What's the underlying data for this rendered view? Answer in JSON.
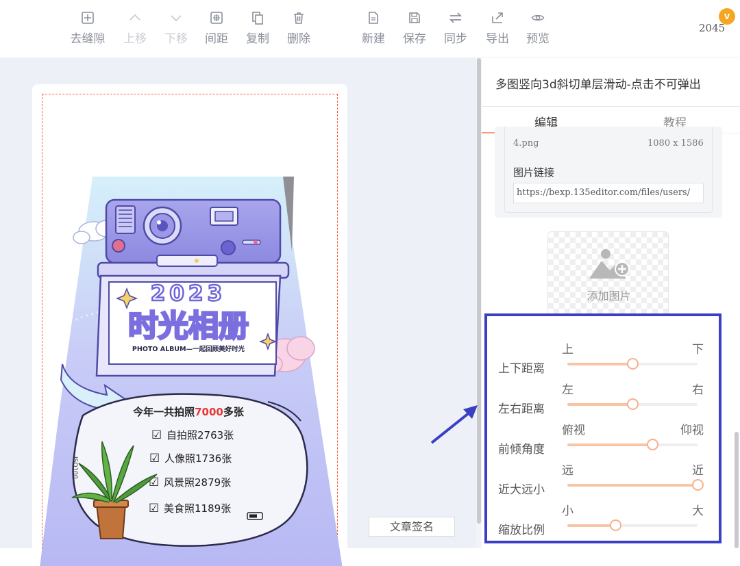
{
  "toolbar": {
    "buttons": [
      {
        "label": "去缝隙",
        "icon": "plus-square-icon",
        "enabled": true
      },
      {
        "label": "上移",
        "icon": "chevron-up-icon",
        "enabled": false
      },
      {
        "label": "下移",
        "icon": "chevron-down-icon",
        "enabled": false
      },
      {
        "label": "间距",
        "icon": "spacing-icon",
        "enabled": true
      },
      {
        "label": "复制",
        "icon": "copy-icon",
        "enabled": true
      },
      {
        "label": "删除",
        "icon": "trash-icon",
        "enabled": true
      },
      {
        "label": "新建",
        "icon": "new-file-icon",
        "enabled": true
      },
      {
        "label": "保存",
        "icon": "save-icon",
        "enabled": true
      },
      {
        "label": "同步",
        "icon": "sync-icon",
        "enabled": true
      },
      {
        "label": "导出",
        "icon": "export-icon",
        "enabled": true
      },
      {
        "label": "预览",
        "icon": "eye-icon",
        "enabled": true
      }
    ],
    "counter": "2045",
    "badge": "v"
  },
  "canvas": {
    "signature_button": "文章签名",
    "poster": {
      "year": "2023",
      "title": "时光相册",
      "subtitle": "PHOTO ALBUM—一起回顾美好时光",
      "headline_prefix": "今年一共拍照",
      "headline_number": "7000",
      "headline_suffix": "多张",
      "stats": [
        "自拍照2763张",
        "人像照1736张",
        "风景照2879张",
        "美食照1189张"
      ],
      "iso": "ISO100"
    }
  },
  "panel": {
    "title": "多图竖向3d斜切单层滑动-点击不可弹出",
    "tabs": [
      {
        "label": "编辑",
        "active": true
      },
      {
        "label": "教程",
        "active": false
      }
    ],
    "image": {
      "filename": "4.png",
      "dimensions": "1080 x 1586",
      "link_label": "图片链接",
      "link_value": "https://bexp.135editor.com/files/users/"
    },
    "add_image_label": "添加图片",
    "sliders": [
      {
        "label": "上下距离",
        "min_label": "上",
        "max_label": "下",
        "value": 0.5
      },
      {
        "label": "左右距离",
        "min_label": "左",
        "max_label": "右",
        "value": 0.5
      },
      {
        "label": "前倾角度",
        "min_label": "俯视",
        "max_label": "仰视",
        "value": 0.65
      },
      {
        "label": "近大远小",
        "min_label": "远",
        "max_label": "近",
        "value": 1.0
      },
      {
        "label": "缩放比例",
        "min_label": "小",
        "max_label": "大",
        "value": 0.37
      }
    ]
  },
  "colors": {
    "accent": "#f7b08a",
    "highlight_box": "#3a3fc4",
    "poster_number": "#e53935",
    "poster_title": "#7b6fe0"
  }
}
